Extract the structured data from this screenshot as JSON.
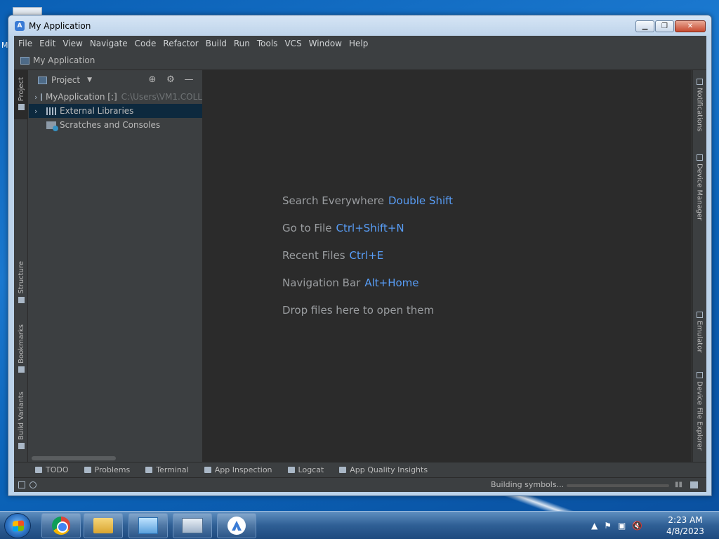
{
  "desktop": {
    "edge_letter": "M"
  },
  "window": {
    "title": "My Application"
  },
  "menu": [
    "File",
    "Edit",
    "View",
    "Navigate",
    "Code",
    "Refactor",
    "Build",
    "Run",
    "Tools",
    "VCS",
    "Window",
    "Help"
  ],
  "navbar": {
    "project": "My Application"
  },
  "left_tabs": {
    "project": "Project",
    "structure": "Structure",
    "bookmarks": "Bookmarks",
    "build_variants": "Build Variants"
  },
  "right_tabs": {
    "notifications": "Notifications",
    "device_manager": "Device Manager",
    "emulator": "Emulator",
    "device_file_explorer": "Device File Explorer"
  },
  "project_panel": {
    "title": "Project",
    "tree": [
      {
        "label": "MyApplication [:]",
        "path": "C:\\Users\\VM1.COLL"
      },
      {
        "label": "External Libraries"
      },
      {
        "label": "Scratches and Consoles"
      }
    ]
  },
  "editor_hints": [
    {
      "text": "Search Everywhere",
      "key": "Double Shift"
    },
    {
      "text": "Go to File",
      "key": "Ctrl+Shift+N"
    },
    {
      "text": "Recent Files",
      "key": "Ctrl+E"
    },
    {
      "text": "Navigation Bar",
      "key": "Alt+Home"
    },
    {
      "text": "Drop files here to open them",
      "key": ""
    }
  ],
  "bottom_tabs": [
    "TODO",
    "Problems",
    "Terminal",
    "App Inspection",
    "Logcat",
    "App Quality Insights"
  ],
  "status": {
    "message": "Building symbols..."
  },
  "taskbar": {
    "time": "2:23 AM",
    "date": "4/8/2023"
  },
  "colors": {
    "editor_bg": "#2b2b2b",
    "panel_bg": "#3c3f41",
    "selection": "#0d293e",
    "shortcut": "#589df6"
  }
}
